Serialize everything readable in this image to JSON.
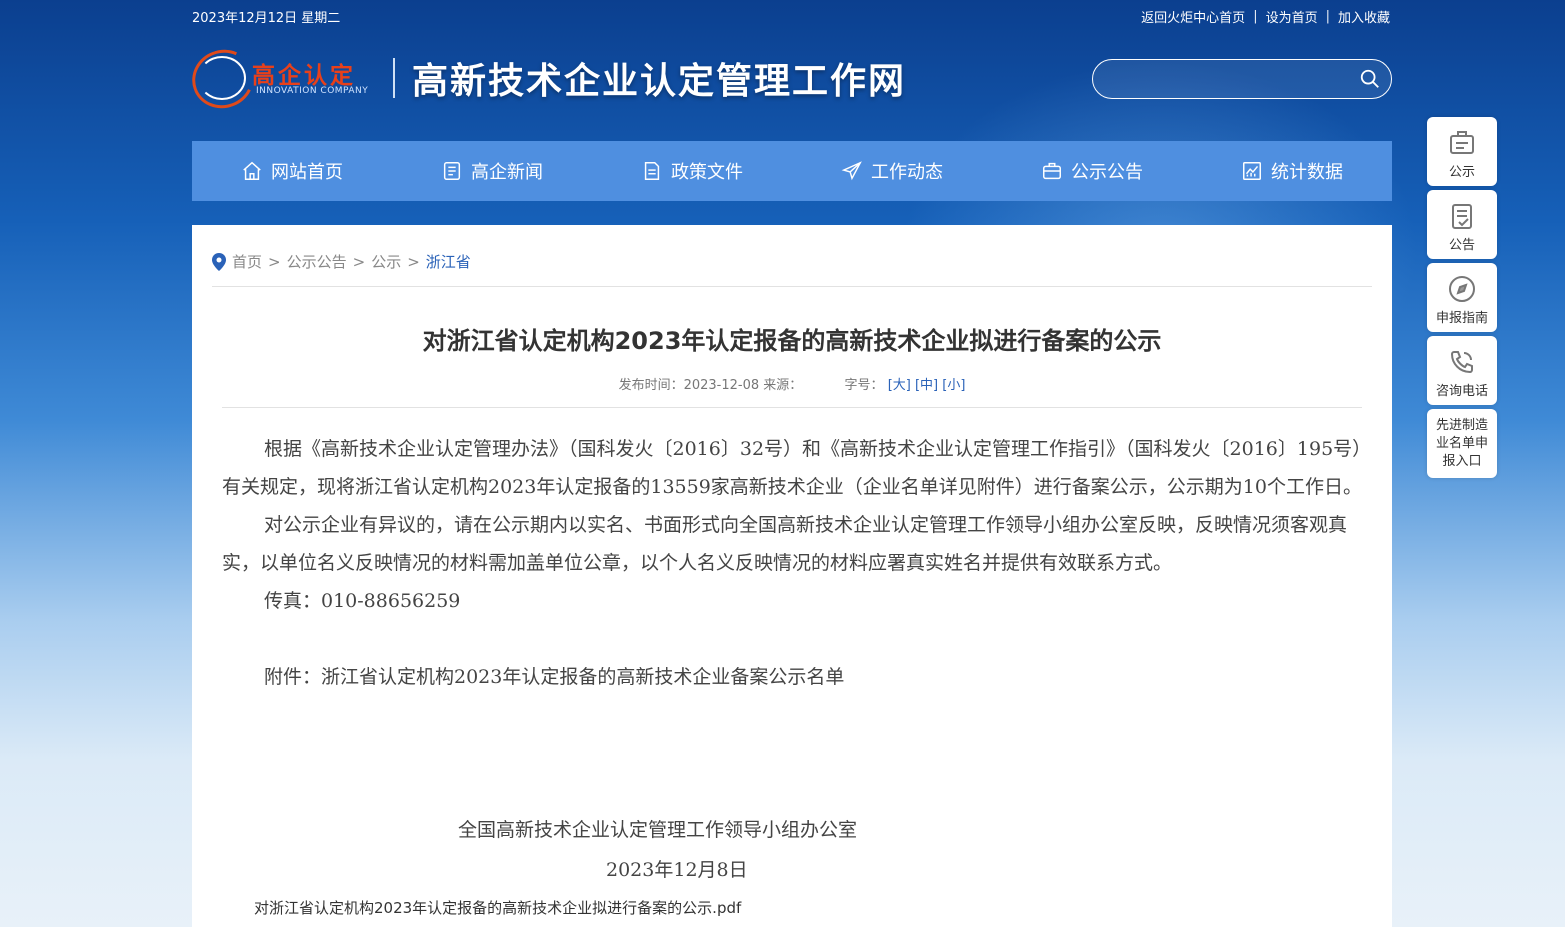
{
  "top_bar": {
    "date": "2023年12月12日 星期二",
    "links": [
      "返回火炬中心首页",
      "设为首页",
      "加入收藏"
    ]
  },
  "logo": {
    "cn": "高企认定",
    "en": "INNOVATION COMPANY"
  },
  "site_title": "高新技术企业认定管理工作网",
  "search": {
    "placeholder": "",
    "icon": "search-icon"
  },
  "nav": [
    {
      "label": "网站首页",
      "icon": "home-icon"
    },
    {
      "label": "高企新闻",
      "icon": "news-icon"
    },
    {
      "label": "政策文件",
      "icon": "document-icon"
    },
    {
      "label": "工作动态",
      "icon": "send-icon"
    },
    {
      "label": "公示公告",
      "icon": "briefcase-icon"
    },
    {
      "label": "统计数据",
      "icon": "chart-icon"
    }
  ],
  "breadcrumb": [
    "首页",
    "公示公告",
    "公示",
    "浙江省"
  ],
  "article": {
    "title": "对浙江省认定机构2023年认定报备的高新技术企业拟进行备案的公示",
    "meta_time": "发布时间：2023-12-08 来源：",
    "meta_size_label": "字号：",
    "size_big": "[大]",
    "size_mid": "[中]",
    "size_small": "[小]",
    "para1": "根据《高新技术企业认定管理办法》（国科发火〔2016〕32号）和《高新技术企业认定管理工作指引》（国科发火〔2016〕195号）有关规定，现将浙江省认定机构2023年认定报备的13559家高新技术企业（企业名单详见附件）进行备案公示，公示期为10个工作日。",
    "para2": "对公示企业有异议的，请在公示期内以实名、书面形式向全国高新技术企业认定管理工作领导小组办公室反映，反映情况须客观真实，以单位名义反映情况的材料需加盖单位公章，以个人名义反映情况的材料应署真实姓名并提供有效联系方式。",
    "fax": "传真：010-88656259",
    "attachment": "附件：浙江省认定机构2023年认定报备的高新技术企业备案公示名单",
    "signature": "全国高新技术企业认定管理工作领导小组办公室",
    "sign_date": "2023年12月8日",
    "pdf": "对浙江省认定机构2023年认定报备的高新技术企业拟进行备案的公示.pdf"
  },
  "side_panel": [
    {
      "label": "公示",
      "icon": "notice-board-icon"
    },
    {
      "label": "公告",
      "icon": "clipboard-icon"
    },
    {
      "label": "申报指南",
      "icon": "compass-icon"
    },
    {
      "label": "咨询电话",
      "icon": "phone-icon"
    },
    {
      "label": "先进制造业名单申报入口",
      "icon": ""
    }
  ]
}
